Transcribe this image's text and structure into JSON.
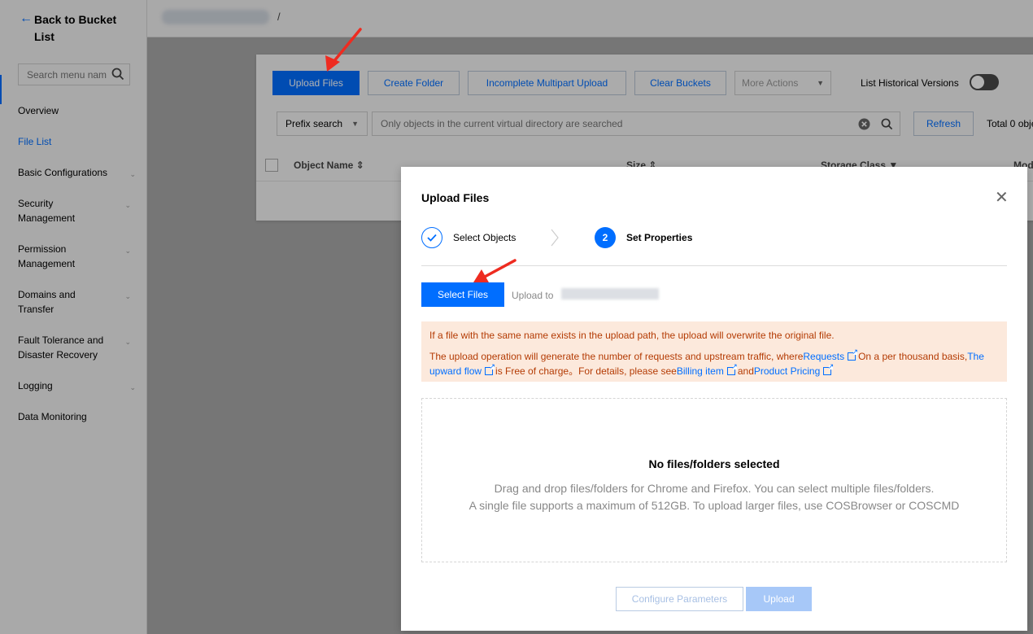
{
  "sidebar": {
    "back_label": "Back to Bucket List",
    "search_placeholder": "Search menu nam",
    "items": [
      {
        "label": "Overview",
        "has_chevron": false
      },
      {
        "label": "File List",
        "active": true,
        "has_chevron": false
      },
      {
        "label": "Basic Configurations",
        "has_chevron": true
      },
      {
        "label": "Security Management",
        "has_chevron": true
      },
      {
        "label": "Permission Management",
        "has_chevron": true
      },
      {
        "label": "Domains and Transfer",
        "has_chevron": true
      },
      {
        "label": "Fault Tolerance and Disaster Recovery",
        "has_chevron": true
      },
      {
        "label": "Logging",
        "has_chevron": true
      },
      {
        "label": "Data Monitoring",
        "has_chevron": false
      }
    ]
  },
  "breadcrumb": {
    "separator": "/"
  },
  "toolbar": {
    "upload_files": "Upload Files",
    "create_folder": "Create Folder",
    "incomplete_upload": "Incomplete Multipart Upload",
    "clear_buckets": "Clear Buckets",
    "more_actions": "More Actions",
    "list_historical_versions": "List Historical Versions",
    "historical_versions_enabled": false
  },
  "search": {
    "prefix_select": "Prefix search",
    "placeholder": "Only objects in the current virtual directory are searched",
    "refresh": "Refresh",
    "total": "Total 0 obje"
  },
  "table": {
    "columns": [
      "Object Name",
      "Size",
      "Storage Class",
      "Mod"
    ]
  },
  "modal": {
    "title": "Upload Files",
    "steps": [
      {
        "number": "1",
        "label": "Select Objects",
        "done": true
      },
      {
        "number": "2",
        "label": "Set Properties",
        "current": true
      }
    ],
    "select_files": "Select Files",
    "upload_to": "Upload to",
    "alert": {
      "line1": "If a file with the same name exists in the upload path, the upload will overwrite the original file.",
      "seg1": "The upload operation will generate the number of requests and upstream traffic, where",
      "link_requests": "Requests",
      "seg2": "On a per thousand basis,",
      "link_upward": "The upward flow",
      "seg3": "is Free of charge。For details, please see",
      "link_billing": "Billing item",
      "seg4": "and",
      "link_pricing": "Product Pricing"
    },
    "dropzone": {
      "title": "No files/folders selected",
      "line1": "Drag and drop files/folders for Chrome and Firefox. You can select multiple files/folders.",
      "line2": "A single file supports a maximum of 512GB. To upload larger files, use COSBrowser or COSCMD"
    },
    "configure_parameters": "Configure Parameters",
    "upload": "Upload"
  },
  "colors": {
    "primary": "#006eff",
    "annotation_arrow": "#ee2b20",
    "alert_bg": "#fce9dc",
    "alert_text": "#b43b04"
  }
}
